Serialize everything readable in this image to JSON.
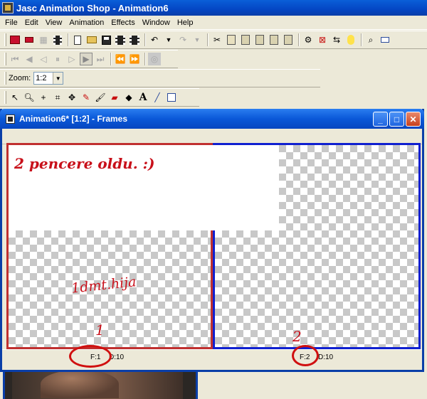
{
  "app": {
    "title": "Jasc Animation Shop - Animation6"
  },
  "menu": [
    "File",
    "Edit",
    "View",
    "Animation",
    "Effects",
    "Window",
    "Help"
  ],
  "zoom": {
    "label": "Zoom:",
    "value": "1:2"
  },
  "frames_window": {
    "title": "Animation6* [1:2] - Frames",
    "frame1": {
      "banner": "2 pencere oldu. :)",
      "signature": "1dmt.hija",
      "number": "1",
      "status_frame": "F:1",
      "status_delay": "D:10"
    },
    "frame2": {
      "number": "2",
      "status_frame": "F:2",
      "status_delay": "D:10"
    }
  },
  "colors": {
    "annotation": "#c8101a",
    "frame1_border": "#c03030",
    "frame2_border": "#1020d0",
    "titlebar": "#0a3ea8"
  }
}
